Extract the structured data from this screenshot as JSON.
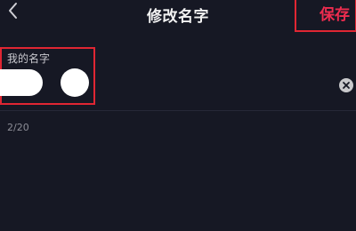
{
  "header": {
    "title": "修改名字",
    "save_label": "保存",
    "back_icon": "chevron-left-icon"
  },
  "name_field": {
    "label": "我的名字",
    "clear_icon": "clear-x-icon"
  },
  "counter": "2/20",
  "colors": {
    "background": "#161824",
    "accent": "#ee2c4f",
    "annotation_box": "#e02633"
  }
}
